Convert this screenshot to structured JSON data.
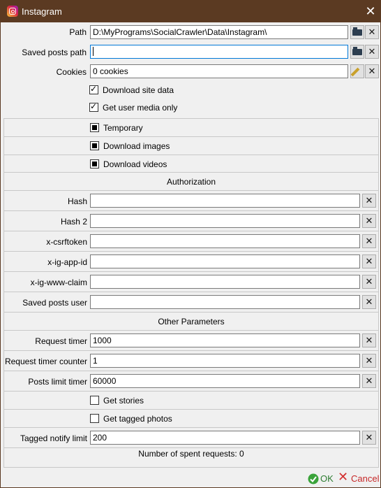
{
  "window": {
    "title": "Instagram",
    "close_glyph": "✕",
    "accent": "#5b3a22"
  },
  "fields": {
    "path": {
      "label": "Path",
      "value": "D:\\MyPrograms\\SocialCrawler\\Data\\Instagram\\"
    },
    "saved_posts_path": {
      "label": "Saved posts path",
      "value": ""
    },
    "cookies": {
      "label": "Cookies",
      "value": "0 cookies"
    }
  },
  "checks": {
    "download_site_data": {
      "label": "Download site data",
      "checked": true
    },
    "get_user_media_only": {
      "label": "Get user media only",
      "checked": true
    },
    "temporary": {
      "label": "Temporary",
      "state": "indeterminate"
    },
    "download_images": {
      "label": "Download images",
      "state": "indeterminate"
    },
    "download_videos": {
      "label": "Download videos",
      "state": "indeterminate"
    },
    "get_stories": {
      "label": "Get stories",
      "checked": false
    },
    "get_tagged_photos": {
      "label": "Get tagged photos",
      "checked": false
    }
  },
  "sections": {
    "authorization": "Authorization",
    "other_parameters": "Other Parameters"
  },
  "auth": {
    "hash": {
      "label": "Hash",
      "value": ""
    },
    "hash2": {
      "label": "Hash 2",
      "value": ""
    },
    "csrftoken": {
      "label": "x-csrftoken",
      "value": ""
    },
    "app_id": {
      "label": "x-ig-app-id",
      "value": ""
    },
    "www_claim": {
      "label": "x-ig-www-claim",
      "value": ""
    },
    "saved_posts_user": {
      "label": "Saved posts user",
      "value": ""
    }
  },
  "params": {
    "request_timer": {
      "label": "Request timer",
      "value": "1000"
    },
    "request_timer_counter": {
      "label": "Request timer counter",
      "value": "1"
    },
    "posts_limit_timer": {
      "label": "Posts limit timer",
      "value": "60000"
    },
    "tagged_notify_limit": {
      "label": "Tagged notify limit",
      "value": "200"
    }
  },
  "status": {
    "spent_requests": "Number of spent requests: 0"
  },
  "footer": {
    "ok_label": "OK",
    "cancel_label": "Cancel"
  },
  "icons": {
    "clear": "✕",
    "folder": "folder-open-icon",
    "pencil": "pencil-icon"
  }
}
